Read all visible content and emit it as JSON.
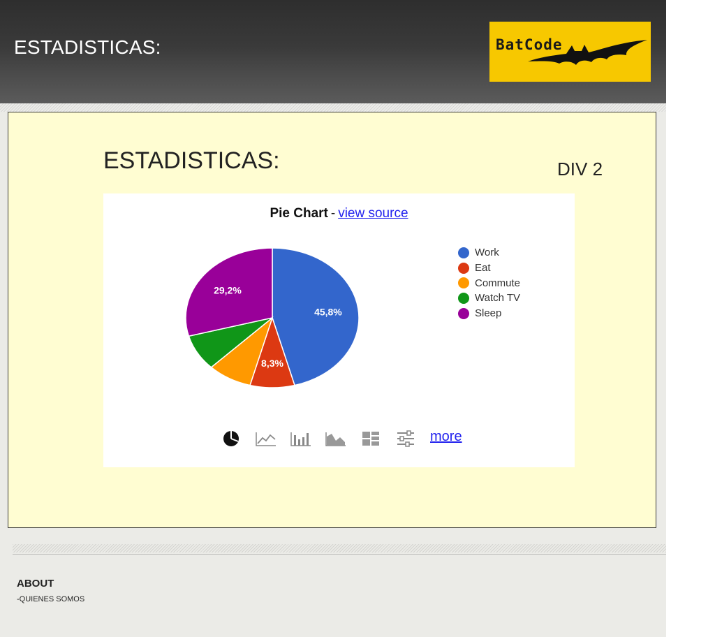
{
  "header": {
    "title": "ESTADISTICAS:",
    "logo_text": "BatCode",
    "logo_bg_color": "#f7c800"
  },
  "content": {
    "title": "ESTADISTICAS:",
    "div_label": "DIV 2"
  },
  "chart": {
    "title": "Pie Chart",
    "separator": "-",
    "source_link": "view source",
    "more_link": "more",
    "toolbar_icons": [
      "pie-chart-icon",
      "line-chart-icon",
      "bar-chart-icon",
      "area-chart-icon",
      "treemap-icon",
      "settings-sliders-icon"
    ]
  },
  "chart_data": {
    "type": "pie",
    "title": "Pie Chart",
    "legend_position": "right",
    "slices": [
      {
        "label": "Work",
        "value": 45.8,
        "display": "45,8%",
        "color": "#3366cc"
      },
      {
        "label": "Eat",
        "value": 8.3,
        "display": "8,3%",
        "color": "#dc3912"
      },
      {
        "label": "Commute",
        "value": 8.3,
        "display": "",
        "color": "#ff9900"
      },
      {
        "label": "Watch TV",
        "value": 8.3,
        "display": "",
        "color": "#109618"
      },
      {
        "label": "Sleep",
        "value": 29.2,
        "display": "29,2%",
        "color": "#990099"
      }
    ]
  },
  "footer": {
    "heading": "ABOUT",
    "link": "-QUIENES SOMOS"
  }
}
